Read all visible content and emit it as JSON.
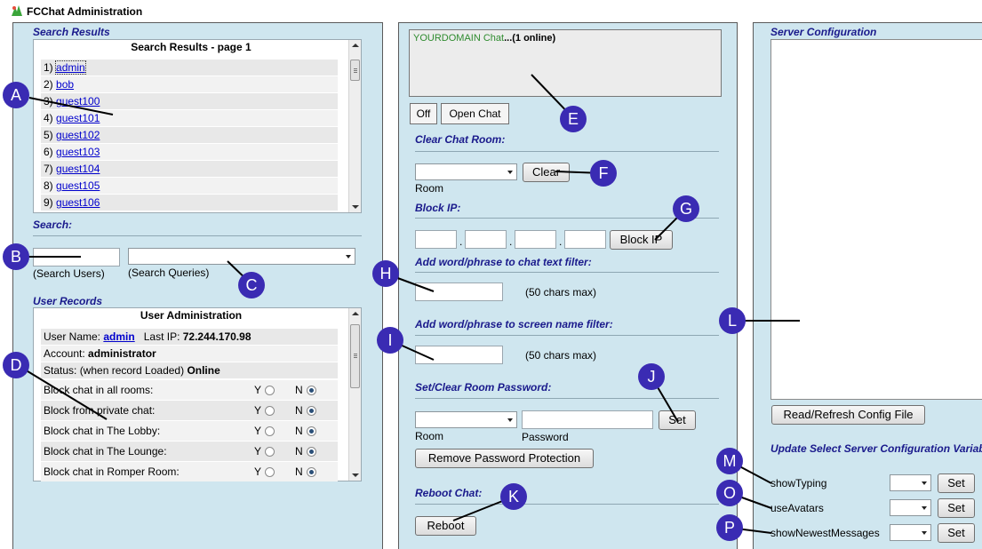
{
  "app": {
    "title": "FCChat Administration"
  },
  "left": {
    "search_results_heading": "Search Results",
    "results_box_title": "Search Results - page 1",
    "results": [
      {
        "num": "1)",
        "name": "admin"
      },
      {
        "num": "2)",
        "name": "bob"
      },
      {
        "num": "3)",
        "name": "guest100"
      },
      {
        "num": "4)",
        "name": "guest101"
      },
      {
        "num": "5)",
        "name": "guest102"
      },
      {
        "num": "6)",
        "name": "guest103"
      },
      {
        "num": "7)",
        "name": "guest104"
      },
      {
        "num": "8)",
        "name": "guest105"
      },
      {
        "num": "9)",
        "name": "guest106"
      }
    ],
    "search_heading": "Search:",
    "search_users_value": "",
    "search_users_label": "(Search Users)",
    "search_queries_value": "",
    "search_queries_label": "(Search Queries)",
    "user_records_heading": "User Records",
    "user_box_title": "User Administration",
    "username_label": "User Name:",
    "username_value": "admin",
    "lastip_label": "Last IP:",
    "lastip_value": "72.244.170.98",
    "account_label": "Account:",
    "account_value": "administrator",
    "status_label": "Status: (when record Loaded)",
    "status_value": "Online",
    "block_rows": [
      {
        "label": "Block chat in all rooms:",
        "y": "Y",
        "n": "N"
      },
      {
        "label": "Block from private chat:",
        "y": "Y",
        "n": "N"
      },
      {
        "label": "Block chat in The Lobby:",
        "y": "Y",
        "n": "N"
      },
      {
        "label": "Block chat in The Lounge:",
        "y": "Y",
        "n": "N"
      },
      {
        "label": "Block chat in Romper Room:",
        "y": "Y",
        "n": "N"
      }
    ]
  },
  "middle": {
    "chat_domain": "YOURDOMAIN Chat",
    "chat_online": "...(1 online)",
    "off_button": "Off",
    "open_chat_button": "Open Chat",
    "clear_room_heading": "Clear Chat Room:",
    "room_label": "Room",
    "clear_button": "Clear",
    "block_ip_heading": "Block IP:",
    "ip_dots": ".",
    "block_ip_button": "Block IP",
    "chat_filter_heading": "Add word/phrase to chat text filter:",
    "chars_max": "(50 chars max)",
    "name_filter_heading": "Add word/phrase to screen name filter:",
    "room_password_heading": "Set/Clear Room Password:",
    "password_label": "Password",
    "set_button": "Set",
    "remove_password_button": "Remove Password Protection",
    "reboot_heading": "Reboot Chat:",
    "reboot_button": "Reboot"
  },
  "right": {
    "server_config_heading": "Server Configuration",
    "read_config_button": "Read/Refresh Config File",
    "update_heading": "Update Select Server Configuration Variables",
    "vars": [
      {
        "name": "showTyping",
        "button": "Set"
      },
      {
        "name": "useAvatars",
        "button": "Set"
      },
      {
        "name": "showNewestMessages",
        "button": "Set"
      }
    ]
  },
  "markers": [
    "A",
    "B",
    "C",
    "D",
    "E",
    "F",
    "G",
    "H",
    "I",
    "J",
    "K",
    "L",
    "M",
    "O",
    "P"
  ],
  "colors": {
    "panel": "#cfe6ef",
    "heading": "#1a1a8c",
    "marker": "#3a2bb3",
    "link": "#0000cc",
    "chat_text": "#2e8b2e"
  }
}
